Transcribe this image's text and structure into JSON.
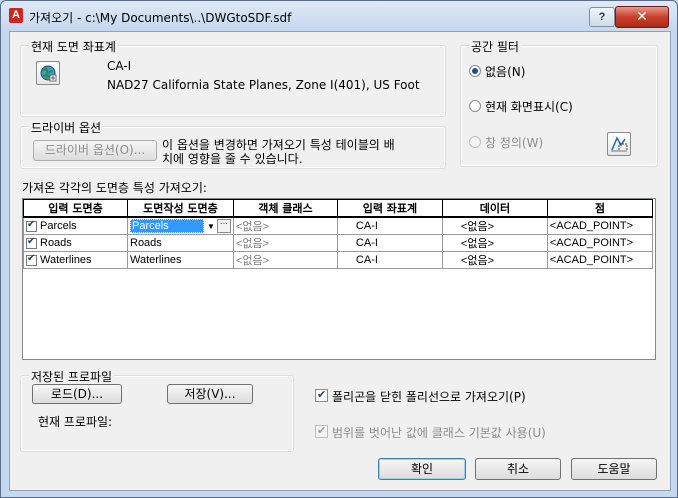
{
  "window": {
    "app_icon_letter": "A",
    "title": "가져오기 - c:\\My Documents\\..\\DWGtoSDF.sdf",
    "help_label": "?",
    "close_label": "✕"
  },
  "current_cs": {
    "legend": "현재 도면 좌표계",
    "code": "CA-I",
    "description": "NAD27 California State Planes, Zone I(401), US Foot",
    "icon": "globe-icon"
  },
  "spatial_filter": {
    "legend": "공간 필터",
    "options": [
      {
        "label": "없음(N)",
        "checked": true,
        "enabled": true
      },
      {
        "label": "현재 화면표시(C)",
        "checked": false,
        "enabled": true
      },
      {
        "label": "창 정의(W)",
        "checked": false,
        "enabled": false
      }
    ],
    "window_icon": "define-window-icon"
  },
  "driver_options": {
    "legend": "드라이버 옵션",
    "button_label": "드라이버 옵션(O)...",
    "note_line1": "이 옵션을 변경하면 가져오기 특성 테이블의 배",
    "note_line2": "치에 영향을 줄 수 있습니다."
  },
  "table": {
    "label": "가져온 각각의 도면층 특성 가져오기:",
    "columns": [
      "입력 도면층",
      "도면작성 도면층",
      "객체 클래스",
      "입력 좌표계",
      "데이터",
      "점"
    ],
    "rows": [
      {
        "checked": true,
        "input_layer": "Parcels",
        "drawing_layer": "Parcels",
        "object_class": "<없음>",
        "input_cs": "CA-I",
        "data": "<없음>",
        "point": "<ACAD_POINT>",
        "editing": true
      },
      {
        "checked": true,
        "input_layer": "Roads",
        "drawing_layer": "Roads",
        "object_class": "<없음>",
        "input_cs": "CA-I",
        "data": "<없음>",
        "point": "<ACAD_POINT>",
        "editing": false
      },
      {
        "checked": true,
        "input_layer": "Waterlines",
        "drawing_layer": "Waterlines",
        "object_class": "<없음>",
        "input_cs": "CA-I",
        "data": "<없음>",
        "point": "<ACAD_POINT>",
        "editing": false
      }
    ]
  },
  "profile": {
    "legend": "저장된 프로파일",
    "load_label": "로드(D)...",
    "save_label": "저장(V)...",
    "current_label": "현재 프로파일:"
  },
  "options": {
    "closed_polyline": {
      "label": "폴리곤을 닫힌 폴리선으로 가져오기(P)",
      "checked": true,
      "enabled": true
    },
    "out_of_range": {
      "label": "범위를 벗어난 값에 클래스 기본값 사용(U)",
      "checked": true,
      "enabled": false
    }
  },
  "buttons": {
    "ok": "확인",
    "cancel": "취소",
    "help": "도움말"
  }
}
